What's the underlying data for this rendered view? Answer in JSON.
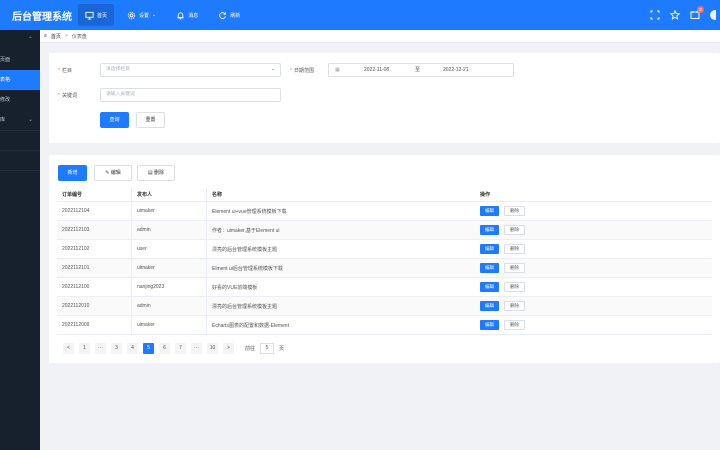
{
  "app": {
    "title": "后台管理系统"
  },
  "header": {
    "nav": [
      {
        "label": "首页",
        "icon": "monitor-icon",
        "active": true
      },
      {
        "label": "设置",
        "icon": "gear-icon",
        "dropdown": true
      },
      {
        "label": "消息",
        "icon": "bell-icon"
      },
      {
        "label": "刷新",
        "icon": "refresh-icon"
      }
    ],
    "notification_count": "2"
  },
  "sidebar": {
    "items": [
      {
        "label": "",
        "chevron": "⌃"
      },
      {
        "label": "页面"
      },
      {
        "label": "表格",
        "active": true
      },
      {
        "label": "修改"
      },
      {
        "label": "库",
        "chevron": "⌄"
      }
    ]
  },
  "breadcrumb": {
    "home": "首页",
    "separator": ">",
    "current": "仪表盘"
  },
  "filter": {
    "column_label": "栏目",
    "column_placeholder": "请选择栏目",
    "date_label": "日期范围",
    "date_start": "2022-11-08",
    "date_to": "至",
    "date_end": "2022-12-21",
    "keyword_label": "关键词",
    "keyword_placeholder": "请输入关键词",
    "query_button": "查询",
    "reset_button": "重置"
  },
  "toolbar": {
    "add": "新增",
    "edit": "编辑",
    "delete": "删除"
  },
  "table": {
    "columns": [
      "订单编号",
      "发布人",
      "名称",
      "操作"
    ],
    "rows": [
      {
        "id": "2022112104",
        "author": "uimaker",
        "name": "Element ui+vue管理系统模板下载"
      },
      {
        "id": "2022112103",
        "author": "admin",
        "name": "作者：uimaker,基于Element ui"
      },
      {
        "id": "2022112102",
        "author": "user",
        "name": "漂亮的后台管理系统模板主题"
      },
      {
        "id": "2022112101",
        "author": "uimaker",
        "name": "Elment ui后台管理系统模板下载"
      },
      {
        "id": "2022112100",
        "author": "nanjing2023",
        "name": "好看的VUE前端模板"
      },
      {
        "id": "2022112010",
        "author": "admin",
        "name": "漂亮的后台管理系统模板主题"
      },
      {
        "id": "2022112009",
        "author": "uimaker",
        "name": "Echarts图表的配置和数据-Element"
      }
    ],
    "row_edit": "编辑",
    "row_delete": "删除"
  },
  "pagination": {
    "prev": "<",
    "next": ">",
    "pages": [
      "1",
      "···",
      "3",
      "4",
      "5",
      "6",
      "7",
      "···",
      "10"
    ],
    "active_page": "5",
    "goto_label": "前往",
    "goto_value": "5",
    "goto_suffix": "页"
  },
  "colors": {
    "primary": "#1e7bff",
    "sidebar": "#17202d",
    "danger": "#f56c6c"
  }
}
